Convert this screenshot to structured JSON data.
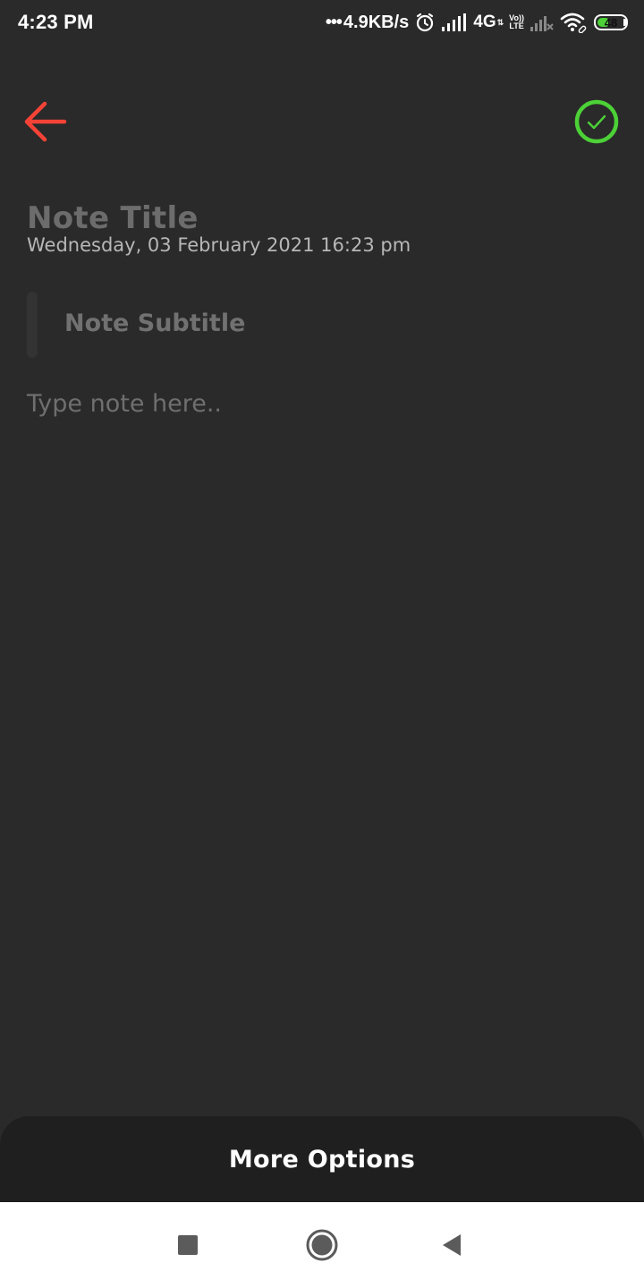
{
  "status_bar": {
    "time": "4:23 PM",
    "dots": "•••",
    "network_speed": "4.9KB/s",
    "network_type": "4G",
    "network_arrows": "⇅",
    "volte_top": "Vo))",
    "volte_bottom": "LTE",
    "battery_level": "48",
    "battery_fraction": 0.48,
    "icons": [
      "alarm-icon",
      "signal-icon",
      "signal-disabled-icon",
      "wifi-icon",
      "battery-icon"
    ]
  },
  "toolbar": {
    "back_icon": "arrow-left-icon",
    "done_icon": "check-circle-icon"
  },
  "note": {
    "title_placeholder": "Note Title",
    "date": "Wednesday, 03 February 2021 16:23 pm",
    "subtitle_placeholder": "Note Subtitle",
    "body_placeholder": "Type note here.."
  },
  "bottom_sheet": {
    "label": "More Options"
  },
  "nav_bar": {
    "icons": [
      "recent-apps-icon",
      "home-icon",
      "back-icon"
    ]
  },
  "colors": {
    "background": "#2a2a2a",
    "back_arrow": "#f44336",
    "done_check": "#4cd137",
    "sheet": "#1f1f1f",
    "nav_bar": "#ffffff"
  }
}
